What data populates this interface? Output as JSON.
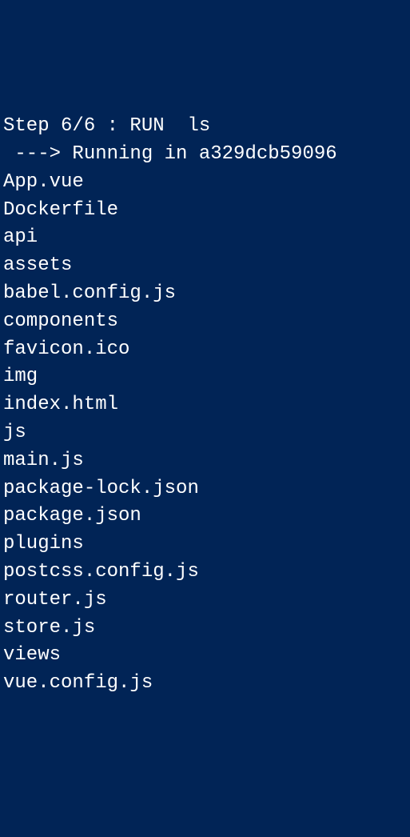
{
  "terminal": {
    "step_line": "Step 6/6 : RUN  ls",
    "running_line": " ---> Running in a329dcb59096",
    "files": [
      "App.vue",
      "Dockerfile",
      "api",
      "assets",
      "babel.config.js",
      "components",
      "favicon.ico",
      "img",
      "index.html",
      "js",
      "main.js",
      "package-lock.json",
      "package.json",
      "plugins",
      "postcss.config.js",
      "router.js",
      "store.js",
      "views",
      "vue.config.js"
    ]
  }
}
